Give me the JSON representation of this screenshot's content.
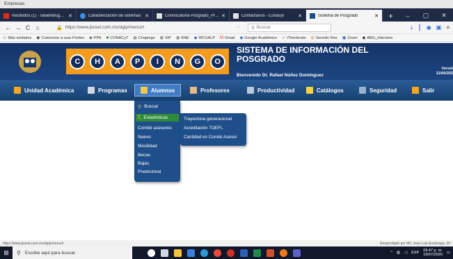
{
  "window": {
    "title": "Empresas"
  },
  "tabs": [
    {
      "label": "Recibidos (1) - rafaelnduguez",
      "icon_color": "#d93025",
      "active": false
    },
    {
      "label": "Caracterización de sistemas",
      "icon_color": "#3d8ee8",
      "active": false
    },
    {
      "label": "Convocatoria Posgrado_Primav",
      "icon_color": "#e0e0e0",
      "active": false
    },
    {
      "label": "Contáctanos - Conacyt",
      "icon_color": "#e0e0e0",
      "active": false
    },
    {
      "label": "Sistema de Posgrado",
      "icon_color": "#1f4d86",
      "active": true
    }
  ],
  "window_controls": {
    "new_tab": "+",
    "minimize": "–",
    "maximize": "▢",
    "close": "✕"
  },
  "browser": {
    "url": "https://www.jluiset.com.mx/dgip/menu/#",
    "search_placeholder": "Buscar",
    "back": "←",
    "forward": "→",
    "reload": "C",
    "home": "⌂",
    "more": "···"
  },
  "bookmarks": [
    {
      "label": "Más visitados",
      "icon": "☆"
    },
    {
      "label": "Comenzar a usar Firefox",
      "icon": "◉"
    },
    {
      "label": "PPA",
      "icon": "◈"
    },
    {
      "label": "CONACyT",
      "icon": "■"
    },
    {
      "label": "Chapingo",
      "icon": "◍"
    },
    {
      "label": "SIP",
      "icon": "◍"
    },
    {
      "label": "RAE",
      "icon": "◍"
    },
    {
      "label": "WCSALP",
      "icon": "◆"
    },
    {
      "label": "Gmail",
      "icon": "M"
    },
    {
      "label": "Google Académico",
      "icon": "◆"
    },
    {
      "label": "iThenticate",
      "icon": "✓"
    },
    {
      "label": "Genetic Res",
      "icon": "◍"
    },
    {
      "label": "Zoom",
      "icon": "▣"
    },
    {
      "label": "ABG_interview",
      "icon": "◆"
    }
  ],
  "header": {
    "chapingo_letters": [
      "C",
      "H",
      "A",
      "P",
      "I",
      "N",
      "G",
      "O"
    ],
    "title_line1": "SISTEMA DE INFORMACIÓN DEL",
    "title_line2": "POSGRADO",
    "welcome": "Bienvenido Dr. Rafael Núñez Domínguez",
    "version_label": "Versió",
    "version_date": "11/06/202"
  },
  "menu": [
    {
      "label": "Unidad Académica",
      "icon_color": "#f5a623",
      "active": false
    },
    {
      "label": "Programas",
      "icon_color": "#cfd8e3",
      "active": false
    },
    {
      "label": "Alumnos",
      "icon_color": "#f1c84b",
      "active": true
    },
    {
      "label": "Profesores",
      "icon_color": "#e8b98a",
      "active": false
    },
    {
      "label": "Productividad",
      "icon_color": "#b9c8db",
      "active": false
    },
    {
      "label": "Catálogos",
      "icon_color": "#f5d24b",
      "active": false
    },
    {
      "label": "Seguridad",
      "icon_color": "#9ab3cc",
      "active": false
    },
    {
      "label": "Salir",
      "icon_color": "#f5a623",
      "active": false
    }
  ],
  "dropdown": {
    "buscar": "Buscar",
    "estadisticas": "Estadísticas",
    "comite": "Comité asesores",
    "nuevo": "Nuevo",
    "movilidad": "Movilidad",
    "becas": "Becas",
    "bajas": "Bajas",
    "predoctoral": "Predoctoral"
  },
  "submenu": {
    "trayectoria": "Trayectoria generacional",
    "toefl": "Acreditación TOEFL",
    "cantidad": "Cantidad en Comité Asesor"
  },
  "status": {
    "url": "https://www.jluiset.com.mx/dgip/menu/#",
    "credit": "Desarrollado por MC José Luis Escárraga, 20"
  },
  "taskbar": {
    "search_placeholder": "Escribe aquí para buscar",
    "lang": "ESP",
    "time": "09:47 p. m.",
    "date": "10/07/2020"
  },
  "colors": {
    "header_blue": "#1a3a6e",
    "chapingo_orange": "#f39c1e",
    "highlight_green": "#2e8b3a"
  }
}
